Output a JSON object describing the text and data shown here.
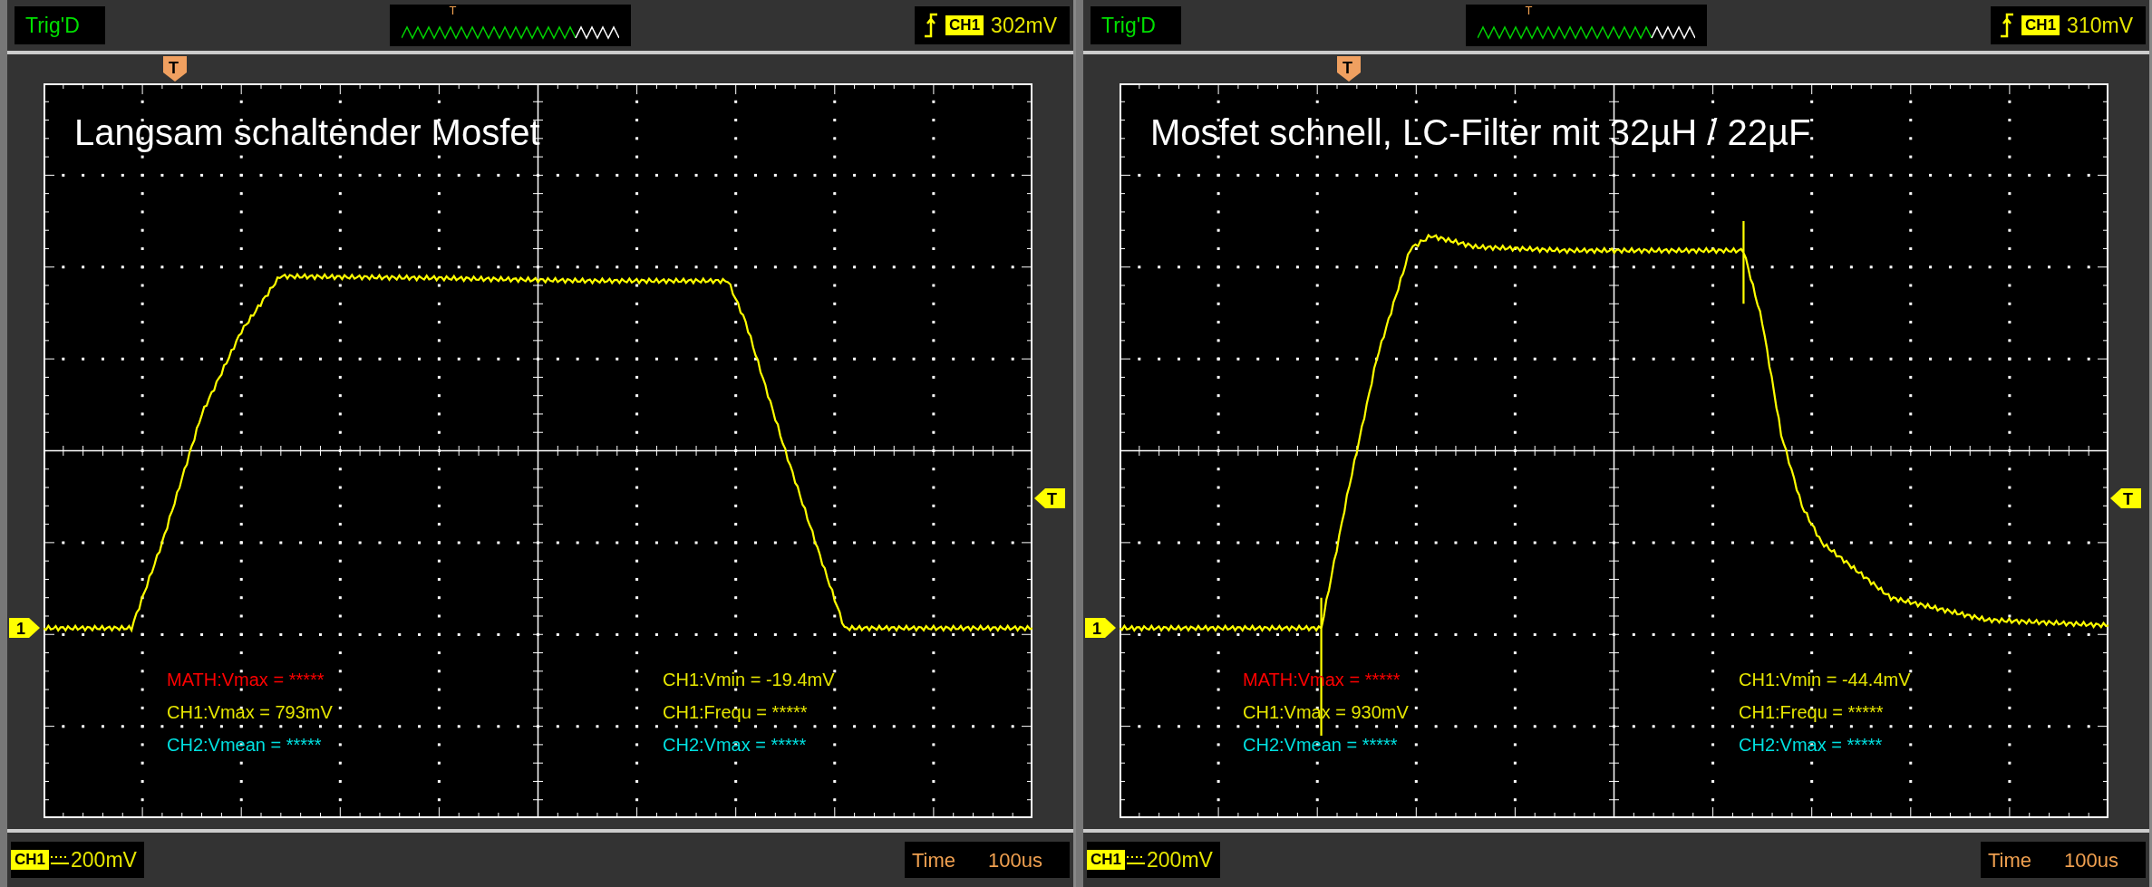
{
  "panels": [
    {
      "status": "Trig'D",
      "preview_marker": "T",
      "trigger": {
        "channel": "CH1",
        "level": "302mV"
      },
      "trigger_marker": "T",
      "title": "Langsam schaltender Mosfet",
      "channel_marker": "1",
      "level_marker": "T",
      "measurements": [
        {
          "text": "MATH:Vmax = *****",
          "color": "#ff0000"
        },
        {
          "text": "CH1:Vmin = -19.4mV",
          "color": "#e6e600"
        },
        {
          "text": "CH1:Vmax = 793mV",
          "color": "#e6e600"
        },
        {
          "text": "CH1:Frequ = *****",
          "color": "#e6e600"
        },
        {
          "text": "CH2:Vmean = *****",
          "color": "#00e0e0"
        },
        {
          "text": "CH2:Vmax = *****",
          "color": "#00e0e0"
        }
      ],
      "footer": {
        "channel": "CH1",
        "scale": "200mV",
        "time_label": "Time",
        "time_value": "100us"
      }
    },
    {
      "status": "Trig'D",
      "preview_marker": "T",
      "trigger": {
        "channel": "CH1",
        "level": "310mV"
      },
      "trigger_marker": "T",
      "title": "Mosfet schnell, LC-Filter mit 32µH / 22µF",
      "channel_marker": "1",
      "level_marker": "T",
      "measurements": [
        {
          "text": "MATH:Vmax = *****",
          "color": "#ff0000"
        },
        {
          "text": "CH1:Vmin = -44.4mV",
          "color": "#e6e600"
        },
        {
          "text": "CH1:Vmax = 930mV",
          "color": "#e6e600"
        },
        {
          "text": "CH1:Frequ = *****",
          "color": "#e6e600"
        },
        {
          "text": "CH2:Vmean = *****",
          "color": "#00e0e0"
        },
        {
          "text": "CH2:Vmax = *****",
          "color": "#00e0e0"
        }
      ],
      "footer": {
        "channel": "CH1",
        "scale": "200mV",
        "time_label": "Time",
        "time_value": "100us"
      }
    }
  ]
}
